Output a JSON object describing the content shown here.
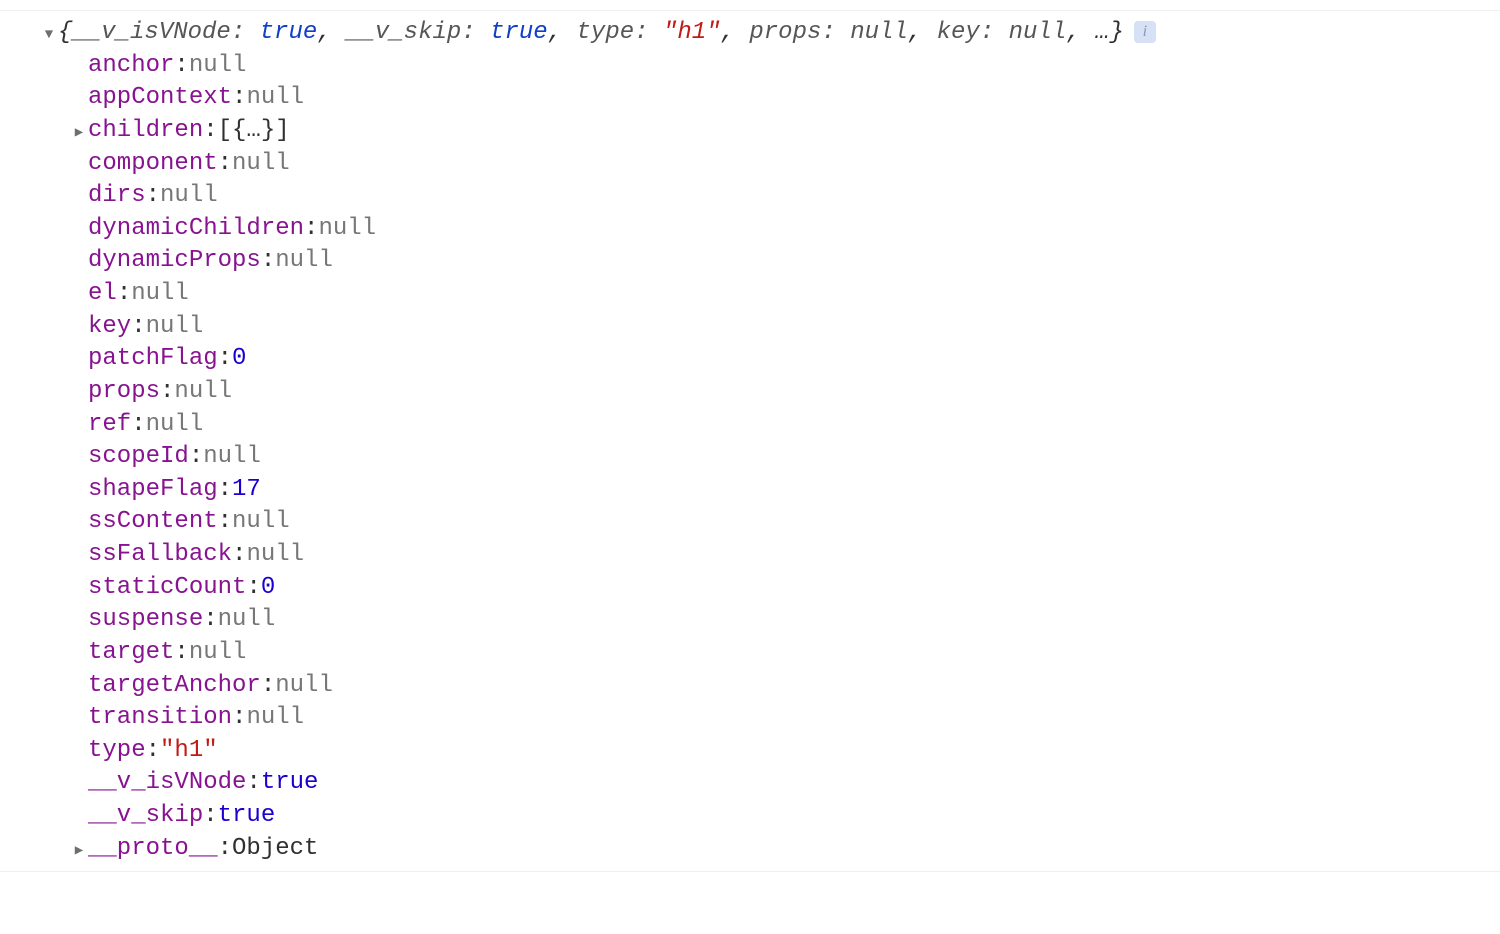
{
  "summary": {
    "openBrace": "{",
    "closeBrace": "}",
    "pairs": [
      {
        "key": "__v_isVNode",
        "valText": "true",
        "valClass": "preview-bool"
      },
      {
        "key": "__v_skip",
        "valText": "true",
        "valClass": "preview-bool"
      },
      {
        "key": "type",
        "valText": "\"h1\"",
        "valClass": "preview-str"
      },
      {
        "key": "props",
        "valText": "null",
        "valClass": "preview-val"
      },
      {
        "key": "key",
        "valText": "null",
        "valClass": "preview-val"
      }
    ],
    "ellipsis": "…",
    "infoBadge": "i"
  },
  "properties": [
    {
      "key": "anchor",
      "valText": "null",
      "valClass": "val-null",
      "expandable": false
    },
    {
      "key": "appContext",
      "valText": "null",
      "valClass": "val-null",
      "expandable": false
    },
    {
      "key": "children",
      "valText": "[{…}]",
      "valClass": "val-arr",
      "expandable": true
    },
    {
      "key": "component",
      "valText": "null",
      "valClass": "val-null",
      "expandable": false
    },
    {
      "key": "dirs",
      "valText": "null",
      "valClass": "val-null",
      "expandable": false
    },
    {
      "key": "dynamicChildren",
      "valText": "null",
      "valClass": "val-null",
      "expandable": false
    },
    {
      "key": "dynamicProps",
      "valText": "null",
      "valClass": "val-null",
      "expandable": false
    },
    {
      "key": "el",
      "valText": "null",
      "valClass": "val-null",
      "expandable": false
    },
    {
      "key": "key",
      "valText": "null",
      "valClass": "val-null",
      "expandable": false
    },
    {
      "key": "patchFlag",
      "valText": "0",
      "valClass": "val-num",
      "expandable": false
    },
    {
      "key": "props",
      "valText": "null",
      "valClass": "val-null",
      "expandable": false
    },
    {
      "key": "ref",
      "valText": "null",
      "valClass": "val-null",
      "expandable": false
    },
    {
      "key": "scopeId",
      "valText": "null",
      "valClass": "val-null",
      "expandable": false
    },
    {
      "key": "shapeFlag",
      "valText": "17",
      "valClass": "val-num",
      "expandable": false
    },
    {
      "key": "ssContent",
      "valText": "null",
      "valClass": "val-null",
      "expandable": false
    },
    {
      "key": "ssFallback",
      "valText": "null",
      "valClass": "val-null",
      "expandable": false
    },
    {
      "key": "staticCount",
      "valText": "0",
      "valClass": "val-num",
      "expandable": false
    },
    {
      "key": "suspense",
      "valText": "null",
      "valClass": "val-null",
      "expandable": false
    },
    {
      "key": "target",
      "valText": "null",
      "valClass": "val-null",
      "expandable": false
    },
    {
      "key": "targetAnchor",
      "valText": "null",
      "valClass": "val-null",
      "expandable": false
    },
    {
      "key": "transition",
      "valText": "null",
      "valClass": "val-null",
      "expandable": false
    },
    {
      "key": "type",
      "valText": "\"h1\"",
      "valClass": "val-str",
      "expandable": false
    },
    {
      "key": "__v_isVNode",
      "valText": "true",
      "valClass": "val-bool",
      "expandable": false
    },
    {
      "key": "__v_skip",
      "valText": "true",
      "valClass": "val-bool",
      "expandable": false
    },
    {
      "key": "__proto__",
      "valText": "Object",
      "valClass": "val-obj",
      "expandable": true
    }
  ]
}
